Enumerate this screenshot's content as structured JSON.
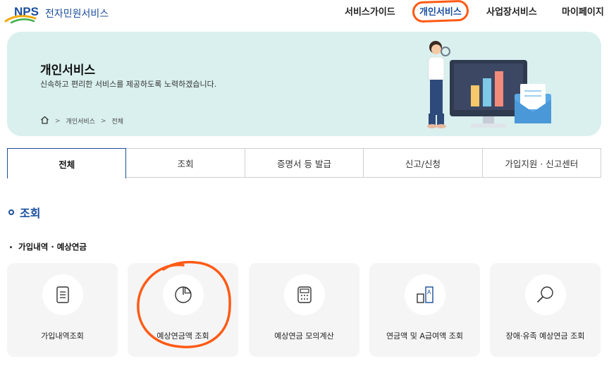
{
  "header": {
    "logo_mark": "NPS",
    "logo_text": "전자민원서비스",
    "nav": [
      {
        "label": "서비스가이드"
      },
      {
        "label": "개인서비스"
      },
      {
        "label": "사업장서비스"
      },
      {
        "label": "마이페이지"
      }
    ]
  },
  "banner": {
    "title": "개인서비스",
    "description": "신속하고 편리한 서비스를 제공하도록 노력하겠습니다.",
    "breadcrumb": [
      "개인서비스",
      "전체"
    ]
  },
  "tabs": [
    {
      "label": "전체"
    },
    {
      "label": "조회"
    },
    {
      "label": "증명서 등 발급"
    },
    {
      "label": "신고/신청"
    },
    {
      "label": "가입지원 · 신고센터"
    }
  ],
  "section": {
    "title": "조회",
    "subtitle": "가입내역 · 예상연금"
  },
  "cards": [
    {
      "label": "가입내역조회",
      "icon": "document-icon"
    },
    {
      "label": "예상연금액 조회",
      "icon": "pie-chart-icon"
    },
    {
      "label": "예상연금 모의계산",
      "icon": "calculator-icon"
    },
    {
      "label": "연금액 및 A급여액 조회",
      "icon": "bar-compare-icon"
    },
    {
      "label": "장애·유족 예상연금 조회",
      "icon": "magnifier-icon"
    }
  ],
  "colors": {
    "brand": "#1a4e9e",
    "banner_bg": "#d9f0ee",
    "annotation": "#ff5a14",
    "card_bg": "#f5f5f5"
  }
}
